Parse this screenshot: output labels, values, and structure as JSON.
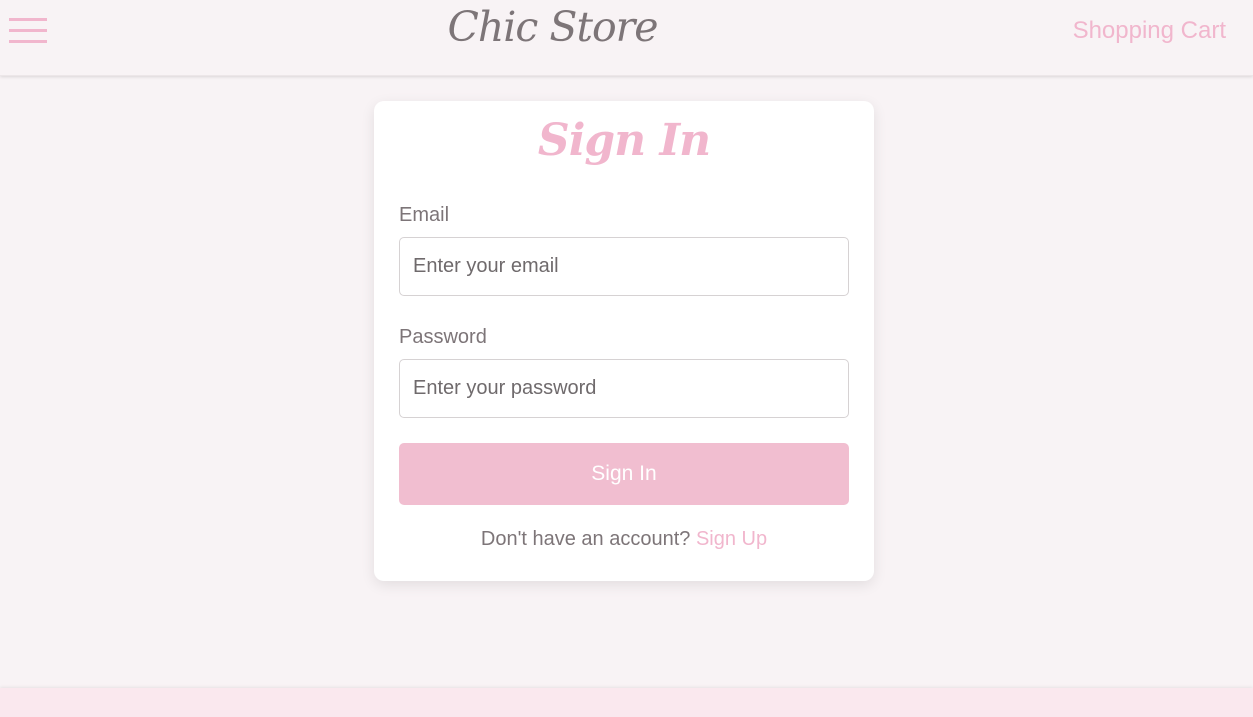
{
  "header": {
    "menu_icon": "hamburger-menu-icon",
    "logo": "Chic Store",
    "cart_link": "Shopping Cart"
  },
  "signin_form": {
    "title": "Sign In",
    "email": {
      "label": "Email",
      "placeholder": "Enter your email",
      "value": ""
    },
    "password": {
      "label": "Password",
      "placeholder": "Enter your password",
      "value": ""
    },
    "submit_label": "Sign In",
    "signup_prompt": "Don't have an account?",
    "signup_link": "Sign Up"
  },
  "colors": {
    "accent_pink": "#f1b6cd",
    "button_pink": "#f1bed0",
    "text_gray": "#7d7578",
    "page_background": "#f8f3f5",
    "footer_background": "#fae8ee"
  }
}
